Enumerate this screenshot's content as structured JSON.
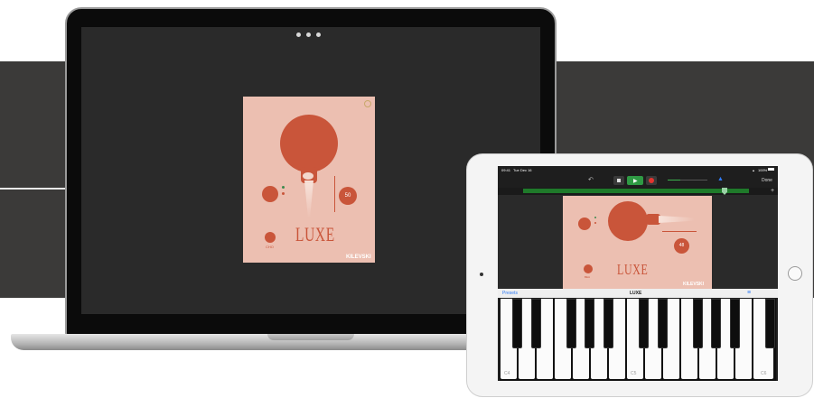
{
  "mac": {
    "plugin": {
      "knob_value": "50",
      "small_knob_label": "CHO",
      "title": "LUXE",
      "brand": "KILEVSKI"
    }
  },
  "ipad": {
    "status": {
      "time": "09:41",
      "date": "Tue Dec 16",
      "battery": "100%"
    },
    "toolbar": {
      "done_label": "Done"
    },
    "plugin": {
      "knob_value": "48",
      "small_knob_label": "BEA",
      "title": "LUXE",
      "brand": "KILEVSKI"
    },
    "keyboard": {
      "presets_label": "Presets",
      "instrument_name": "LUXE",
      "octave_labels": [
        "C4",
        "C5",
        "C6"
      ]
    }
  },
  "colors": {
    "accent": "#c9553a",
    "panel": "#ecbfb1",
    "ruler_green": "#1f7a2a",
    "link_blue": "#2f7bf5"
  }
}
